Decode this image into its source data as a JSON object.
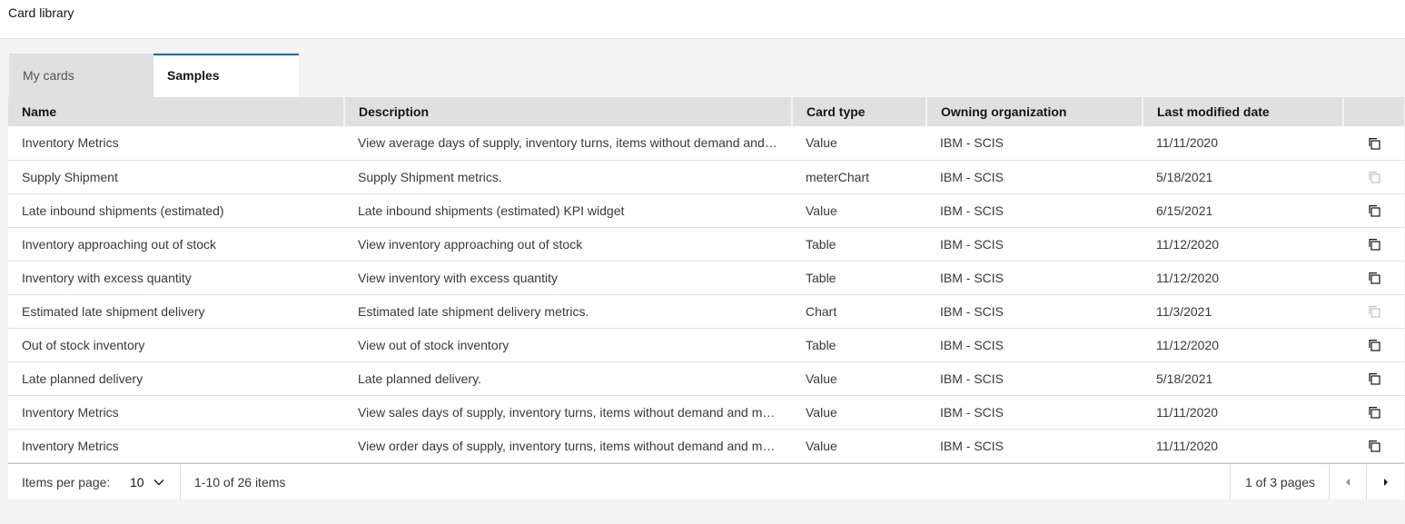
{
  "header": {
    "title": "Card library"
  },
  "tabs": [
    {
      "label": "My cards",
      "active": false
    },
    {
      "label": "Samples",
      "active": true
    }
  ],
  "table": {
    "columns": [
      "Name",
      "Description",
      "Card type",
      "Owning organization",
      "Last modified date",
      ""
    ],
    "rows": [
      {
        "name": "Inventory Metrics",
        "description": "View average days of supply, inventory turns, items without demand and more",
        "type": "Value",
        "org": "IBM - SCIS",
        "date": "11/11/2020",
        "copy_enabled": true
      },
      {
        "name": "Supply Shipment",
        "description": "Supply Shipment metrics.",
        "type": "meterChart",
        "org": "IBM - SCIS",
        "date": "5/18/2021",
        "copy_enabled": false
      },
      {
        "name": "Late inbound shipments (estimated)",
        "description": "Late inbound shipments (estimated) KPI widget",
        "type": "Value",
        "org": "IBM - SCIS",
        "date": "6/15/2021",
        "copy_enabled": true
      },
      {
        "name": "Inventory approaching out of stock",
        "description": "View inventory approaching out of stock",
        "type": "Table",
        "org": "IBM - SCIS",
        "date": "11/12/2020",
        "copy_enabled": true
      },
      {
        "name": "Inventory with excess quantity",
        "description": "View inventory with excess quantity",
        "type": "Table",
        "org": "IBM - SCIS",
        "date": "11/12/2020",
        "copy_enabled": true
      },
      {
        "name": "Estimated late shipment delivery",
        "description": "Estimated late shipment delivery metrics.",
        "type": "Chart",
        "org": "IBM - SCIS",
        "date": "11/3/2021",
        "copy_enabled": false
      },
      {
        "name": "Out of stock inventory",
        "description": "View out of stock inventory",
        "type": "Table",
        "org": "IBM - SCIS",
        "date": "11/12/2020",
        "copy_enabled": true
      },
      {
        "name": "Late planned delivery",
        "description": "Late planned delivery.",
        "type": "Value",
        "org": "IBM - SCIS",
        "date": "5/18/2021",
        "copy_enabled": true
      },
      {
        "name": "Inventory Metrics",
        "description": "View sales days of supply, inventory turns, items without demand and more",
        "type": "Value",
        "org": "IBM - SCIS",
        "date": "11/11/2020",
        "copy_enabled": true
      },
      {
        "name": "Inventory Metrics",
        "description": "View order days of supply, inventory turns, items without demand and more",
        "type": "Value",
        "org": "IBM - SCIS",
        "date": "11/11/2020",
        "copy_enabled": true
      }
    ]
  },
  "pagination": {
    "items_per_page_label": "Items per page:",
    "items_per_page_value": "10",
    "range_text": "1-10 of 26 items",
    "pages_text": "1 of 3 pages"
  },
  "icons": {
    "copy": "copy-icon",
    "chevron_down": "chevron-down-icon",
    "prev": "caret-left-icon",
    "next": "caret-right-icon"
  },
  "colors": {
    "accent": "#0f62fe"
  }
}
